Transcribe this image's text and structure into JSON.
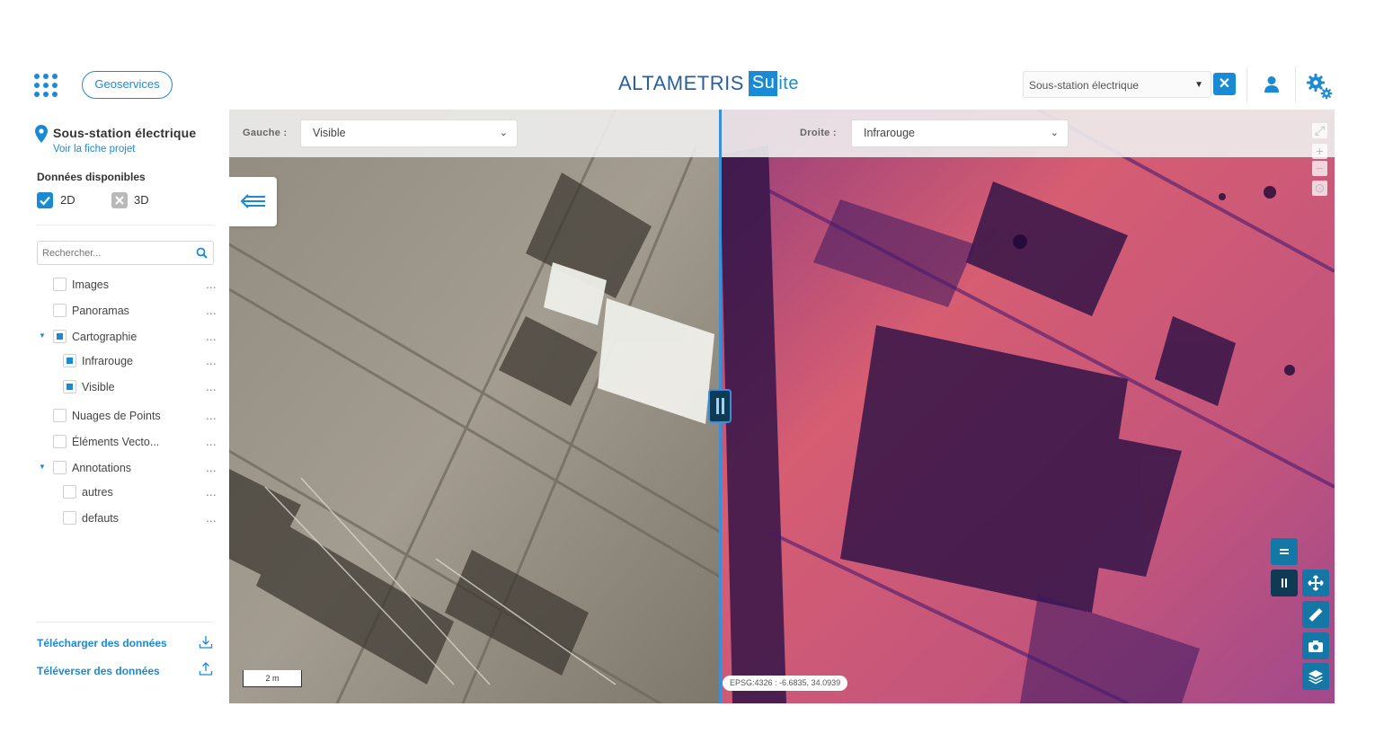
{
  "header": {
    "geoservices_label": "Geoservices",
    "brand_main": "ALTAMETRIS",
    "brand_suite_box": "Su",
    "brand_suite_rest": "ite",
    "project_select_value": "Sous-station électrique"
  },
  "sidebar": {
    "project_title": "Sous-station électrique",
    "project_link": "Voir la fiche projet",
    "available_data_label": "Données disponibles",
    "option_2d": "2D",
    "option_3d": "3D",
    "search_placeholder": "Rechercher...",
    "tree": [
      {
        "label": "Images",
        "checked": false
      },
      {
        "label": "Panoramas",
        "checked": false
      },
      {
        "label": "Cartographie",
        "checked": true,
        "expanded": true
      },
      {
        "label": "Infrarouge",
        "checked": true
      },
      {
        "label": "Visible",
        "checked": true
      },
      {
        "label": "Nuages de Points",
        "checked": false
      },
      {
        "label": "Éléments Vecto...",
        "checked": false
      },
      {
        "label": "Annotations",
        "checked": false,
        "expanded": true
      },
      {
        "label": "autres",
        "checked": false
      },
      {
        "label": "defauts",
        "checked": false
      }
    ],
    "more_glyph": "...",
    "download_label": "Télécharger des données",
    "upload_label": "Téléverser des données"
  },
  "map": {
    "left_label": "Gauche :",
    "left_value": "Visible",
    "right_label": "Droite :",
    "right_value": "Infrarouge",
    "scale_label": "2 m",
    "coords_label": "EPSG:4326 : -6.6835, 34.0939",
    "colors": {
      "accent": "#1a8ad4",
      "tool_bg": "#1577a6",
      "divider": "#3b8fd8"
    }
  }
}
